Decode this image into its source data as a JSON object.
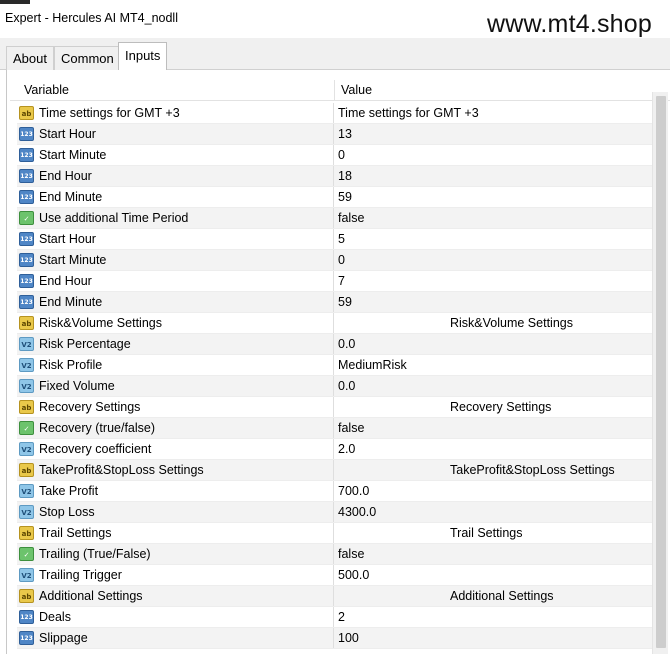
{
  "window": {
    "title": "Expert - Hercules AI MT4_nodll",
    "watermark": "www.mt4.shop"
  },
  "tabs": [
    {
      "label": "About",
      "active": false
    },
    {
      "label": "Common",
      "active": false
    },
    {
      "label": "Inputs",
      "active": true
    }
  ],
  "table": {
    "headers": {
      "variable": "Variable",
      "value": "Value"
    },
    "rows": [
      {
        "type": "string",
        "icon": "ab",
        "variable": "Time settings for GMT +3",
        "value": "Time settings for GMT +3",
        "section": false
      },
      {
        "type": "int",
        "icon": "123",
        "variable": "Start Hour",
        "value": "13",
        "section": false
      },
      {
        "type": "int",
        "icon": "123",
        "variable": "Start Minute",
        "value": "0",
        "section": false
      },
      {
        "type": "int",
        "icon": "123",
        "variable": "End Hour",
        "value": "18",
        "section": false
      },
      {
        "type": "int",
        "icon": "123",
        "variable": "End Minute",
        "value": "59",
        "section": false
      },
      {
        "type": "bool",
        "icon": "✓",
        "variable": "Use additional Time Period",
        "value": "false",
        "section": false
      },
      {
        "type": "int",
        "icon": "123",
        "variable": "Start Hour",
        "value": "5",
        "section": false
      },
      {
        "type": "int",
        "icon": "123",
        "variable": "Start Minute",
        "value": "0",
        "section": false
      },
      {
        "type": "int",
        "icon": "123",
        "variable": "End Hour",
        "value": "7",
        "section": false
      },
      {
        "type": "int",
        "icon": "123",
        "variable": "End Minute",
        "value": "59",
        "section": false
      },
      {
        "type": "string",
        "icon": "ab",
        "variable": "Risk&Volume Settings",
        "value": "Risk&Volume Settings",
        "section": true
      },
      {
        "type": "double",
        "icon": "V2",
        "variable": "Risk Percentage",
        "value": "0.0",
        "section": false
      },
      {
        "type": "double",
        "icon": "V2",
        "variable": "Risk Profile",
        "value": "MediumRisk",
        "section": false
      },
      {
        "type": "double",
        "icon": "V2",
        "variable": "Fixed Volume",
        "value": "0.0",
        "section": false
      },
      {
        "type": "string",
        "icon": "ab",
        "variable": "Recovery Settings",
        "value": "Recovery Settings",
        "section": true
      },
      {
        "type": "bool",
        "icon": "✓",
        "variable": "Recovery (true/false)",
        "value": "false",
        "section": false
      },
      {
        "type": "double",
        "icon": "V2",
        "variable": "Recovery coefficient",
        "value": "2.0",
        "section": false
      },
      {
        "type": "string",
        "icon": "ab",
        "variable": "TakeProfit&StopLoss Settings",
        "value": "TakeProfit&StopLoss Settings",
        "section": true
      },
      {
        "type": "double",
        "icon": "V2",
        "variable": "Take Profit",
        "value": "700.0",
        "section": false
      },
      {
        "type": "double",
        "icon": "V2",
        "variable": "Stop Loss",
        "value": "4300.0",
        "section": false
      },
      {
        "type": "string",
        "icon": "ab",
        "variable": "Trail Settings",
        "value": "Trail Settings",
        "section": true
      },
      {
        "type": "bool",
        "icon": "✓",
        "variable": "Trailing (True/False)",
        "value": "false",
        "section": false
      },
      {
        "type": "double",
        "icon": "V2",
        "variable": "Trailing Trigger",
        "value": "500.0",
        "section": false
      },
      {
        "type": "string",
        "icon": "ab",
        "variable": "Additional Settings",
        "value": "Additional Settings",
        "section": true
      },
      {
        "type": "int",
        "icon": "123",
        "variable": "Deals",
        "value": "2",
        "section": false
      },
      {
        "type": "int",
        "icon": "123",
        "variable": "Slippage",
        "value": "100",
        "section": false
      }
    ]
  }
}
